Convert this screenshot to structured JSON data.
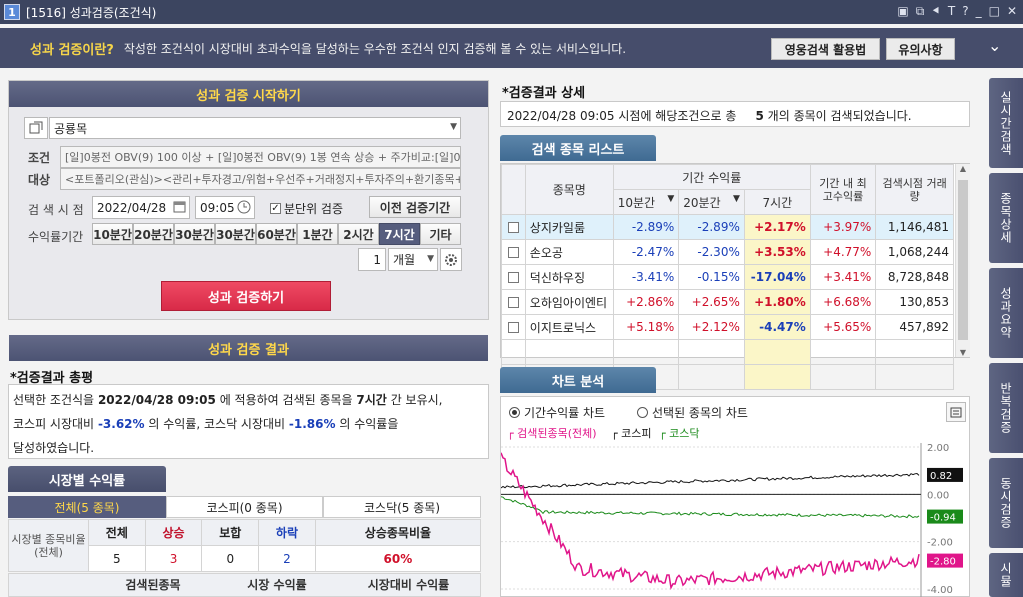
{
  "window": {
    "number": "1",
    "title": "[1516] 성과검증(조건식)",
    "controls": [
      "▣",
      "⧉",
      "⯇",
      "T",
      "?",
      "_",
      "□",
      "✕"
    ]
  },
  "banner": {
    "question": "성과 검증이란?",
    "desc": "작성한 조건식이 시장대비 초과수익을 달성하는 우수한 조건식 인지 검증해 볼 수 있는 서비스입니다.",
    "btn1": "영웅검색 활용법",
    "btn2": "유의사항",
    "collapse": "⌄"
  },
  "left": {
    "start_header": "성과 검증 시작하기",
    "condition_name": "공룡목",
    "cond_label": "조건",
    "target_label": "대상",
    "cond_text": "[일]0봉전 OBV(9) 100 이상 + [일]0봉전 OBV(9) 1봉 연속 상승 + 주가비교:[일]0",
    "target_text": "<포트폴리오(관심)><관리+투자경고/위험+우선주+거래정지+투자주의+환기종목+",
    "time_label": "검 색 시 점",
    "date": "2022/04/28",
    "time": "09:05",
    "minute_check_label": "분단위 검증",
    "prev_btn": "이전 검증기간",
    "period_label": "수익률기간",
    "periods": [
      "10분간",
      "20분간",
      "30분간",
      "30분간",
      "60분간",
      "1분간",
      "2시간",
      "7시간",
      "기타"
    ],
    "count": "1",
    "unit": "개월",
    "run_btn": "성과 검증하기",
    "result_header": "성과 검증 결과",
    "summary_title": "*검증결과 총평",
    "summary": {
      "p1": "선택한 조건식을",
      "date": "2022/04/28 09:05",
      "p2": "에 적용하여 검색된 종목을",
      "period": "7시간",
      "p3": "간 보유시,",
      "p4": "코스피 시장대비",
      "kospi": "-3.62%",
      "p5": "의 수익률, 코스닥 시장대비",
      "kosdaq": "-1.86%",
      "p6": "의 수익률을",
      "p7": "달성하였습니다."
    },
    "market_tab": "시장별 수익률",
    "market_subtabs": [
      "전체(5 종목)",
      "코스피(0 종목)",
      "코스닥(5 종목)"
    ],
    "market_table": {
      "row_label": "시장별 종목비율 (전체)",
      "headers": [
        "전체",
        "상승",
        "보합",
        "하락",
        "상승종목비율"
      ],
      "values": [
        "5",
        "3",
        "0",
        "2",
        "60%"
      ]
    },
    "bottom_headers": [
      "검색된종목",
      "시장 수익률",
      "시장대비 수익률"
    ]
  },
  "right": {
    "detail_title": "*검증결과 상세",
    "detail_text": {
      "p1": "2022/04/28 09:05 시점에 해당조건으로 총",
      "count": "5",
      "p2": "개의 종목이 검색되었습니다."
    },
    "list_tab": "검색 종목 리스트",
    "list_headers": {
      "name": "종목명",
      "period": "기간 수익률",
      "p10": "10분간",
      "p20": "20분간",
      "p7": "7시간",
      "max": "기간 내 최고수익률",
      "vol": "검색시점 거래량"
    },
    "rows": [
      {
        "name": "상지카일룸",
        "r10": "-2.89%",
        "r20": "-2.89%",
        "r7": "+2.17%",
        "max": "+3.97%",
        "vol": "1,146,481"
      },
      {
        "name": "손오공",
        "r10": "-2.47%",
        "r20": "-2.30%",
        "r7": "+3.53%",
        "max": "+4.77%",
        "vol": "1,068,244"
      },
      {
        "name": "덕신하우징",
        "r10": "-3.41%",
        "r20": "-0.15%",
        "r7": "-17.04%",
        "max": "+3.41%",
        "vol": "8,728,848"
      },
      {
        "name": "오하임아이엔티",
        "r10": "+2.86%",
        "r20": "+2.65%",
        "r7": "+1.80%",
        "max": "+6.68%",
        "vol": "130,853"
      },
      {
        "name": "이지트로닉스",
        "r10": "+5.18%",
        "r20": "+2.12%",
        "r7": "-4.47%",
        "max": "+5.65%",
        "vol": "457,892"
      }
    ],
    "chart_tab": "차트 분석",
    "radio1": "기간수익률 차트",
    "radio2": "선택된 종목의 차트",
    "legend": {
      "s1": "검색된종목(전체)",
      "s2": "코스피",
      "s3": "코스닥"
    },
    "markers": {
      "kospi": "0.82",
      "kosdaq": "-0.94",
      "stocks": "-2.80"
    }
  },
  "sidebar": [
    "실시간검색",
    "종목상세",
    "성과요약",
    "반복검증",
    "동시검증",
    "시뮬"
  ],
  "chart_data": {
    "type": "line",
    "series": [
      {
        "name": "검색된종목(전체)",
        "color": "#e0158a",
        "last": -2.8
      },
      {
        "name": "코스피",
        "color": "#111111",
        "last": 0.82
      },
      {
        "name": "코스닥",
        "color": "#1a8a1a",
        "last": -0.94
      }
    ],
    "yticks": [
      "2.00",
      "0.00",
      "-2.00",
      "-4.00"
    ],
    "ylim": [
      -4.0,
      2.0
    ]
  }
}
